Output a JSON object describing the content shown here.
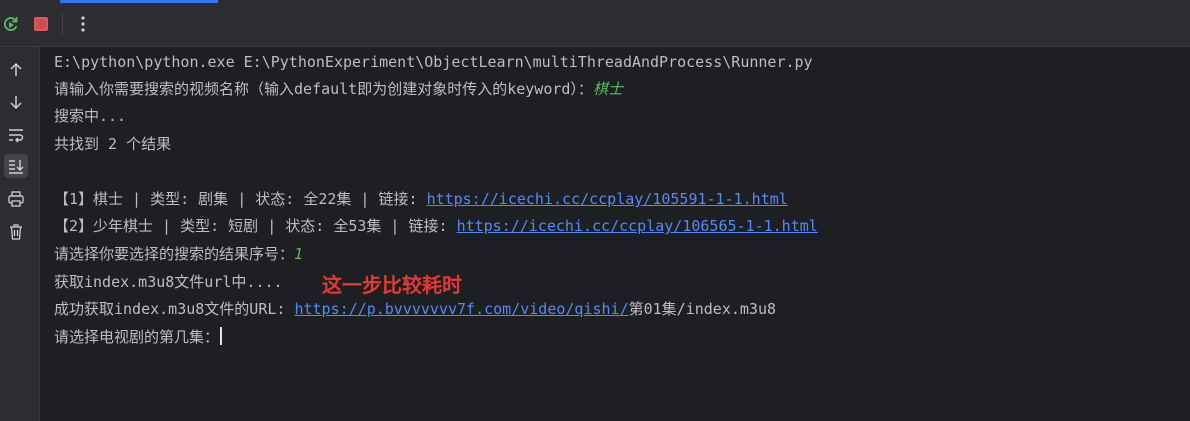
{
  "toolbar": {
    "icons": [
      "rerun-icon",
      "stop-icon",
      "more-options-icon"
    ],
    "colors": {
      "rerun": "#5fb865",
      "stop": "#e55757"
    }
  },
  "sidebar": {
    "icons": [
      "scroll-up-icon",
      "scroll-down-icon",
      "soft-wrap-icon",
      "scroll-to-end-icon",
      "print-icon",
      "clear-icon"
    ]
  },
  "console": {
    "line1": "E:\\python\\python.exe E:\\PythonExperiment\\ObjectLearn\\multiThreadAndProcess\\Runner.py",
    "line2_prompt": "请输入你需要搜索的视频名称（输入default即为创建对象时传入的keyword）：",
    "line2_input": "棋士",
    "line3": "搜索中...",
    "line4": "共找到 2 个结果",
    "result1_text": "【1】棋士 | 类型: 剧集 | 状态: 全22集 | 链接: ",
    "result1_link": "https://icechi.cc/ccplay/105591-1-1.html",
    "result2_text": "【2】少年棋士 | 类型: 短剧 | 状态: 全53集 | 链接: ",
    "result2_link": "https://icechi.cc/ccplay/106565-1-1.html",
    "select_prompt": "请选择你要选择的搜索的结果序号：",
    "select_input": "1",
    "fetching": "获取index.m3u8文件url中....",
    "annotation": "这一步比较耗时",
    "success_text": "成功获取index.m3u8文件的URL: ",
    "success_link": "https://p.bvvvvvvv7f.com/video/qishi/",
    "success_suffix": "第01集/index.m3u8",
    "episode_prompt": "请选择电视剧的第几集："
  }
}
